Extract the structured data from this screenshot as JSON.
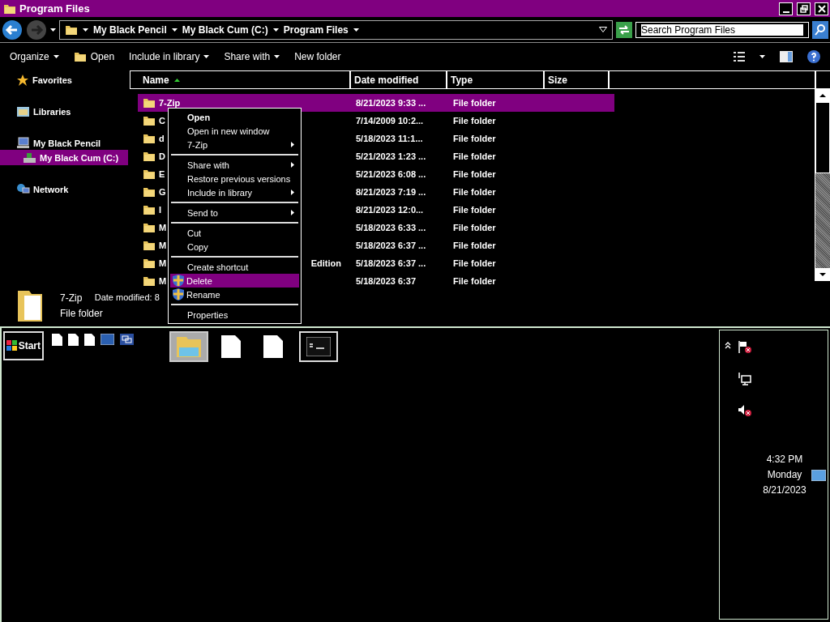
{
  "window": {
    "title": "Program Files"
  },
  "address": {
    "crumbs": [
      "My Black Pencil",
      "My Black Cum (C:)",
      "Program Files"
    ]
  },
  "search": {
    "placeholder": "Search Program Files"
  },
  "toolbar": [
    {
      "label": "Organize",
      "dropdown": true,
      "icon": false
    },
    {
      "label": "Open",
      "dropdown": false,
      "icon": true
    },
    {
      "label": "Include in library",
      "dropdown": true,
      "icon": false
    },
    {
      "label": "Share with",
      "dropdown": true,
      "icon": false
    },
    {
      "label": "New folder",
      "dropdown": false,
      "icon": false
    }
  ],
  "sidebar": {
    "items": [
      {
        "label": "Favorites",
        "kind": "star",
        "selected": false
      },
      {
        "label": "Libraries",
        "kind": "library",
        "selected": false
      },
      {
        "label": "My Black Pencil",
        "kind": "computer",
        "selected": false,
        "children": [
          {
            "label": "My Black Cum (C:)",
            "kind": "drive",
            "selected": true
          }
        ]
      },
      {
        "label": "Network",
        "kind": "network",
        "selected": false
      }
    ]
  },
  "table": {
    "columns": [
      "Name",
      "Date modified",
      "Type",
      "Size"
    ],
    "rows": [
      {
        "name": "7-Zip",
        "date": "8/21/2023 9:33 ...",
        "type": "File folder",
        "selected": true
      },
      {
        "name": "C",
        "date": "7/14/2009 10:2...",
        "type": "File folder",
        "selected": false
      },
      {
        "name": "d",
        "date": "5/18/2023 11:1...",
        "type": "File folder",
        "selected": false
      },
      {
        "name": "D",
        "date": "5/21/2023 1:23 ...",
        "type": "File folder",
        "selected": false
      },
      {
        "name": "E",
        "date": "5/21/2023 6:08 ...",
        "type": "File folder",
        "selected": false
      },
      {
        "name": "G",
        "date": "8/21/2023 7:19 ...",
        "type": "File folder",
        "selected": false
      },
      {
        "name": "I",
        "date": "8/21/2023 12:0...",
        "type": "File folder",
        "selected": false
      },
      {
        "name": "M",
        "date": "5/18/2023 6:33 ...",
        "type": "File folder",
        "selected": false
      },
      {
        "name": "M",
        "date": "5/18/2023 6:37 ...",
        "type": "File folder",
        "selected": false
      },
      {
        "name": "M",
        "tail": "Edition",
        "date": "5/18/2023 6:37 ...",
        "type": "File folder",
        "selected": false
      },
      {
        "name": "M",
        "date": "5/18/2023 6:37",
        "type": "File folder",
        "selected": false
      }
    ]
  },
  "details": {
    "name": "7-Zip",
    "date": "Date modified: 8",
    "type": "File folder"
  },
  "context_menu": {
    "groups": [
      [
        {
          "label": "Open",
          "kind": "default",
          "submenu": false,
          "selected": false
        },
        {
          "label": "Open in new window",
          "kind": "plain",
          "submenu": false,
          "selected": false
        },
        {
          "label": "7-Zip",
          "kind": "plain",
          "submenu": true,
          "selected": false
        }
      ],
      [
        {
          "label": "Share with",
          "kind": "plain",
          "submenu": true,
          "selected": false
        },
        {
          "label": "Restore previous versions",
          "kind": "plain",
          "submenu": false,
          "selected": false
        },
        {
          "label": "Include in library",
          "kind": "plain",
          "submenu": true,
          "selected": false
        }
      ],
      [
        {
          "label": "Send to",
          "kind": "plain",
          "submenu": true,
          "selected": false
        }
      ],
      [
        {
          "label": "Cut",
          "kind": "plain",
          "submenu": false,
          "selected": false
        },
        {
          "label": "Copy",
          "kind": "plain",
          "submenu": false,
          "selected": false
        }
      ],
      [
        {
          "label": "Create shortcut",
          "kind": "plain",
          "submenu": false,
          "selected": false
        },
        {
          "label": "Delete",
          "kind": "shield",
          "submenu": false,
          "selected": true
        },
        {
          "label": "Rename",
          "kind": "shield",
          "submenu": false,
          "selected": false
        }
      ],
      [
        {
          "label": "Properties",
          "kind": "plain",
          "submenu": false,
          "selected": false
        }
      ]
    ]
  },
  "taskbar": {
    "start": "Start",
    "quick_launch": [
      {
        "kind": "document"
      },
      {
        "kind": "document"
      },
      {
        "kind": "document"
      },
      {
        "kind": "desktop"
      },
      {
        "kind": "windows"
      }
    ],
    "tasks": [
      {
        "kind": "explorer",
        "selected": true
      },
      {
        "kind": "document",
        "selected": false
      },
      {
        "kind": "document",
        "selected": false
      },
      {
        "kind": "console",
        "selected": false
      }
    ],
    "tray": [
      {
        "kind": "flag"
      },
      {
        "kind": "network"
      },
      {
        "kind": "speaker"
      }
    ],
    "time": "4:32 PM",
    "day": "Monday",
    "date": "8/21/2023"
  }
}
